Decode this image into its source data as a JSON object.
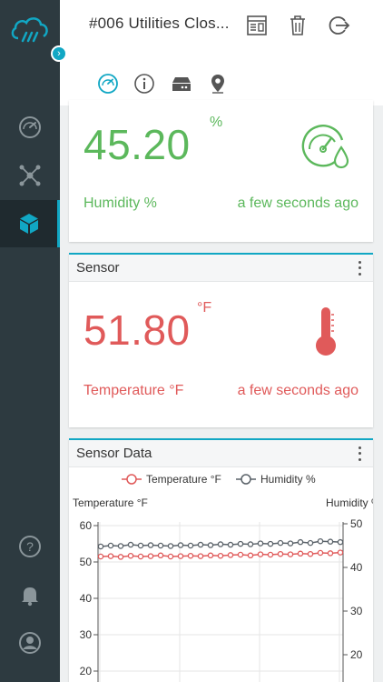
{
  "header": {
    "title": "#006 Utilities Clos...",
    "tabs": [
      {
        "icon": "gauge-icon",
        "active": true
      },
      {
        "icon": "info-icon",
        "active": false
      },
      {
        "icon": "gateway-icon",
        "active": false
      },
      {
        "icon": "location-pin-icon",
        "active": false
      }
    ]
  },
  "sidebar": {
    "items": [
      {
        "icon": "dashboard-gauge-icon"
      },
      {
        "icon": "network-nodes-icon"
      },
      {
        "icon": "cube-icon",
        "active": true
      },
      {
        "icon": "help-icon"
      },
      {
        "icon": "bell-icon"
      },
      {
        "icon": "user-icon"
      }
    ],
    "expand_glyph": "›"
  },
  "humidity_card": {
    "value": "45.20",
    "unit": "%",
    "label": "Humidity %",
    "updated": "a few seconds ago",
    "color": "#5cb85c"
  },
  "temperature_card": {
    "title": "Sensor",
    "value": "51.80",
    "unit": "°F",
    "label": "Temperature °F",
    "updated": "a few seconds ago",
    "color": "#e05a5a"
  },
  "chart_card": {
    "title": "Sensor Data"
  },
  "chart_data": {
    "type": "line",
    "legend": [
      "Temperature °F",
      "Humidity %"
    ],
    "ylabel_left": "Temperature °F",
    "ylabel_right": "Humidity %",
    "left_ticks": [
      "60",
      "50",
      "40",
      "30",
      "20"
    ],
    "right_ticks": [
      "50",
      "40",
      "30",
      "20"
    ],
    "ylim_left": [
      20,
      60
    ],
    "ylim_right": [
      20,
      50
    ],
    "grid": true,
    "series": [
      {
        "name": "Temperature °F",
        "color": "#e05a5a",
        "values": [
          51.5,
          51.6,
          51.4,
          51.7,
          51.5,
          51.6,
          51.8,
          51.5,
          51.6,
          51.7,
          51.6,
          51.8,
          51.7,
          51.9,
          52.0,
          51.8,
          52.1,
          52.0,
          52.2,
          52.1,
          52.3,
          52.2,
          52.5,
          52.4,
          52.6
        ]
      },
      {
        "name": "Humidity %",
        "color": "#5a6269",
        "values": [
          44.8,
          45.0,
          44.9,
          45.2,
          45.0,
          45.1,
          45.0,
          44.9,
          45.1,
          45.0,
          45.2,
          45.1,
          45.3,
          45.2,
          45.4,
          45.3,
          45.5,
          45.4,
          45.6,
          45.5,
          45.8,
          45.6,
          46.0,
          45.9,
          45.8
        ]
      }
    ]
  }
}
